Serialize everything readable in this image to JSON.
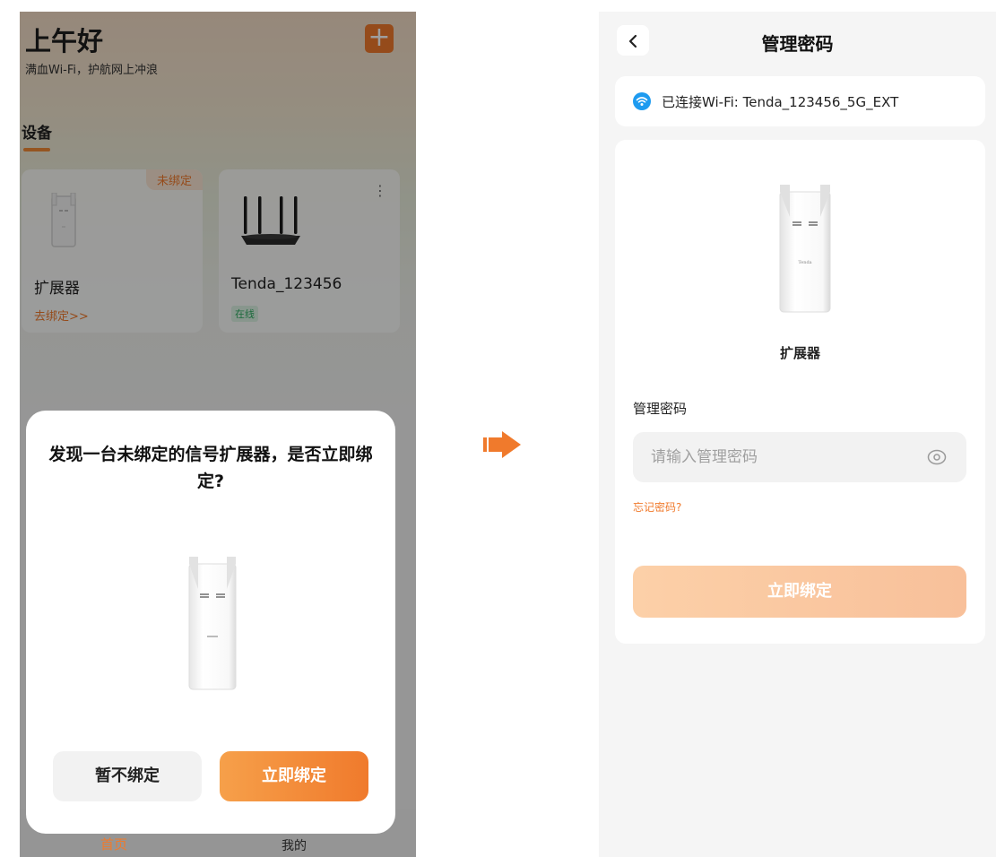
{
  "left_screen": {
    "greeting": "上午好",
    "subtitle": "满血Wi-Fi，护航网上冲浪",
    "add_button": "+",
    "section_title": "设备",
    "devices": [
      {
        "name": "扩展器",
        "badge": "未绑定",
        "action": "去绑定>>"
      },
      {
        "name": "Tenda_123456",
        "status": "在线",
        "menu": "⋮"
      }
    ],
    "dialog": {
      "message": "发现一台未绑定的信号扩展器，是否立即绑定?",
      "cancel_label": "暂不绑定",
      "confirm_label": "立即绑定"
    },
    "tabs": [
      {
        "label": "首页",
        "active": true
      },
      {
        "label": "我的",
        "active": false
      }
    ]
  },
  "right_screen": {
    "title": "管理密码",
    "back_icon": "chevron-left-icon",
    "wifi_status": "已连接Wi-Fi:  Tenda_123456_5G_EXT",
    "device_name": "扩展器",
    "device_brand": "Tenda",
    "password_label": "管理密码",
    "password_placeholder": "请输入管理密码",
    "forgot_password": "忘记密码?",
    "bind_button": "立即绑定"
  },
  "colors": {
    "accent": "#f07a2c",
    "online": "#2eab62",
    "wifi_icon": "#1e9bf0"
  }
}
